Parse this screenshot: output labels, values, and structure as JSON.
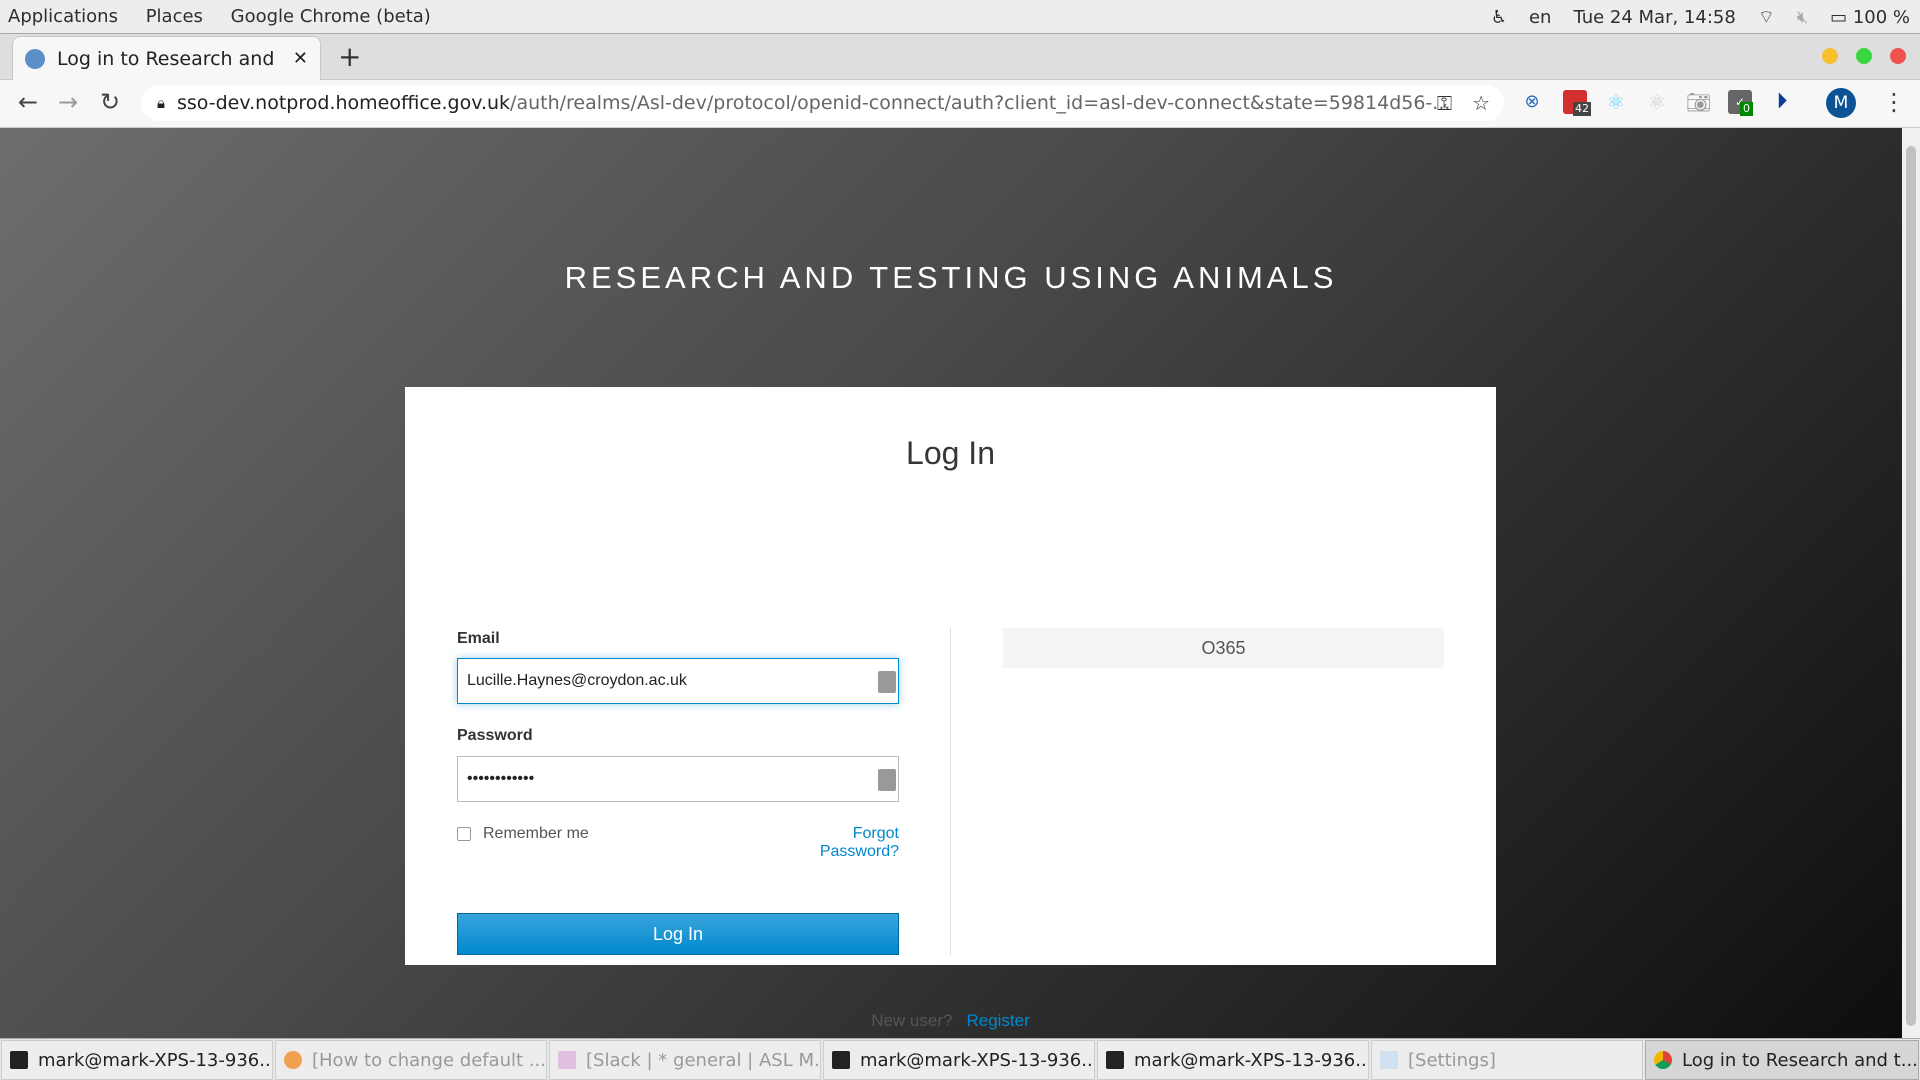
{
  "system_bar": {
    "menus": [
      "Applications",
      "Places",
      "Google Chrome (beta)"
    ],
    "language": "en",
    "datetime": "Tue 24 Mar, 14:58",
    "battery": "100 %"
  },
  "browser": {
    "tab_title": "Log in to Research and",
    "url_host": "sso-dev.notprod.homeoffice.gov.uk",
    "url_path": "/auth/realms/Asl-dev/protocol/openid-connect/auth?client_id=asl-dev-connect&state=59814d56-...",
    "extension_badges": {
      "ext_red": "42",
      "ext_task": "0"
    },
    "profile_initial": "M",
    "window_dots": {
      "minimize": "#f6c02f",
      "maximize": "#3bd743",
      "close": "#ef5350"
    }
  },
  "page": {
    "brand": "RESEARCH AND TESTING USING ANIMALS",
    "heading": "Log In",
    "email_label": "Email",
    "email_value": "Lucille.Haynes@croydon.ac.uk",
    "password_label": "Password",
    "password_value": "••••••••••••",
    "remember_label": "Remember me",
    "forgot_label": "Forgot Password?",
    "login_button": "Log In",
    "provider_button": "O365",
    "new_user_text": "New user?",
    "register_link": "Register",
    "accent": "#0088ce"
  },
  "taskbar": [
    {
      "label": "mark@mark-XPS-13-936...",
      "icon": "terminal-icon"
    },
    {
      "label": "[How to change default ...",
      "icon": "firefox-icon"
    },
    {
      "label": "[Slack | * general | ASL M...",
      "icon": "slack-icon"
    },
    {
      "label": "mark@mark-XPS-13-936...",
      "icon": "terminal-icon"
    },
    {
      "label": "mark@mark-XPS-13-936...",
      "icon": "terminal-icon"
    },
    {
      "label": "[Settings]",
      "icon": "settings-icon"
    },
    {
      "label": "Log in to Research and t...",
      "icon": "chrome-icon"
    }
  ]
}
